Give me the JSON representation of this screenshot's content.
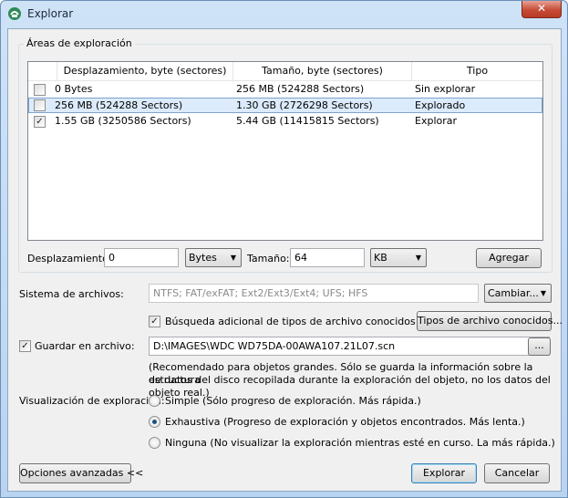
{
  "window": {
    "title": "Explorar",
    "close_glyph": "✕"
  },
  "scan_areas": {
    "legend": "Áreas de exploración",
    "columns": [
      "Desplazamiento, byte (sectores)",
      "Tamaño, byte (sectores)",
      "Tipo"
    ],
    "rows": [
      {
        "checked": false,
        "offset": "0 Bytes",
        "size": "256 MB (524288 Sectors)",
        "type": "Sin explorar"
      },
      {
        "checked": false,
        "offset": "256 MB (524288 Sectors)",
        "size": "1.30 GB (2726298 Sectors)",
        "type": "Explorado",
        "selected": true
      },
      {
        "checked": true,
        "offset": "1.55 GB (3250586 Sectors)",
        "size": "5.44 GB (11415815 Sectors)",
        "type": "Explorar"
      }
    ],
    "offset_label": "Desplazamiento:",
    "offset_value": "0",
    "offset_unit": "Bytes",
    "size_label": "Tamaño:",
    "size_value": "64",
    "size_unit": "KB",
    "add_button": "Agregar"
  },
  "filesystems": {
    "label": "Sistema de archivos:",
    "value": "NTFS; FAT/exFAT; Ext2/Ext3/Ext4; UFS; HFS",
    "change_button": "Cambiar..."
  },
  "known_types": {
    "checkbox_label": "Búsqueda adicional de tipos de archivo conocidos",
    "checked": true,
    "button": "Tipos de archivo conocidos..."
  },
  "save_to_file": {
    "checkbox_label": "Guardar en archivo:",
    "checked": true,
    "path": "D:\\IMAGES\\WDC WD75DA-00AWA107.21L07.scn",
    "browse_button": "...",
    "note_line1": "(Recomendado para objetos grandes. Sólo se guarda la información sobre la estructura",
    "note_line2": "de datos del disco recopilada durante la exploración del objeto, no los datos del objeto real.)"
  },
  "visualization": {
    "label": "Visualización de exploración:",
    "options": [
      {
        "label": "Simple (Sólo progreso de exploración. Más rápida.)",
        "checked": false
      },
      {
        "label": "Exhaustiva (Progreso de exploración y objetos encontrados. Más lenta.)",
        "checked": true
      },
      {
        "label": "Ninguna (No visualizar la exploración mientras esté en curso. La más rápida.)",
        "checked": false
      }
    ]
  },
  "footer": {
    "advanced_button": "Opciones avanzadas <<",
    "scan_button": "Explorar",
    "cancel_button": "Cancelar"
  },
  "check_glyph": "✓",
  "dropdown_glyph": "▼"
}
